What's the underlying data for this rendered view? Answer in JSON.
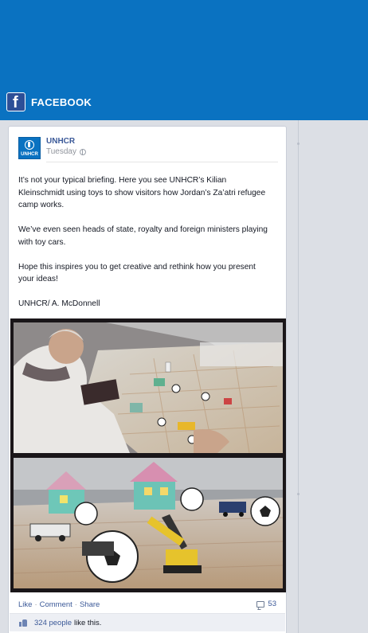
{
  "brand": {
    "title": "FACEBOOK",
    "logo_glyph": "f",
    "color": "#0a72c1"
  },
  "post": {
    "page_name": "UNHCR",
    "avatar_text": "UNHCR",
    "timestamp": "Tuesday",
    "privacy_icon": "globe-icon",
    "paragraphs": [
      "It’s not your typical briefing. Here you see UNHCR’s Kilian Kleinschmidt using toys to show visitors how Jordan’s Za’atri refugee camp works.",
      "We’ve even seen heads of state, royalty and foreign ministers playing with toy cars.",
      "Hope this inspires you to get creative and rethink how you present your ideas!",
      "UNHCR/ A. McDonnell"
    ]
  },
  "actions": {
    "like": "Like",
    "comment": "Comment",
    "share": "Share",
    "separator": "·",
    "comment_count": "53"
  },
  "likes": {
    "count_text": "324 people",
    "suffix": "like this."
  }
}
